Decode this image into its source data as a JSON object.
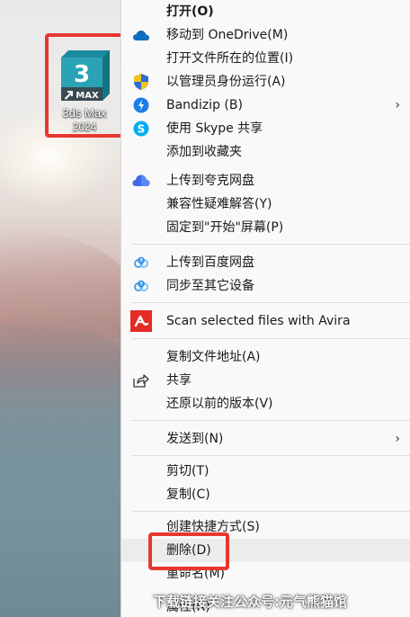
{
  "desktop": {
    "icon_label": "3ds Max",
    "icon_sublabel": "2024",
    "logo_number": "3",
    "logo_text": "MAX"
  },
  "menu": {
    "items": [
      {
        "label": "打开(O)",
        "icon": "none"
      },
      {
        "label": "移动到 OneDrive(M)",
        "icon": "onedrive-cloud-icon"
      },
      {
        "label": "打开文件所在的位置(I)",
        "icon": "none"
      },
      {
        "label": "以管理员身份运行(A)",
        "icon": "uac-shield-icon"
      },
      {
        "label": "Bandizip (B)",
        "icon": "bandizip-icon"
      },
      {
        "label": "使用 Skype 共享",
        "icon": "skype-icon"
      },
      {
        "label": "添加到收藏夹",
        "icon": "none"
      },
      {
        "label": "上传到夸克网盘",
        "icon": "quark-cloud-icon"
      },
      {
        "label": "兼容性疑难解答(Y)",
        "icon": "none"
      },
      {
        "label": "固定到\"开始\"屏幕(P)",
        "icon": "none"
      },
      {
        "label": "上传到百度网盘",
        "icon": "baidu-cloud-icon"
      },
      {
        "label": "同步至其它设备",
        "icon": "baidu-cloud-icon"
      },
      {
        "label": "Scan selected files with Avira",
        "icon": "avira-icon"
      },
      {
        "label": "复制文件地址(A)",
        "icon": "none"
      },
      {
        "label": "共享",
        "icon": "share-icon"
      },
      {
        "label": "还原以前的版本(V)",
        "icon": "none"
      },
      {
        "label": "发送到(N)",
        "icon": "none"
      },
      {
        "label": "剪切(T)",
        "icon": "none"
      },
      {
        "label": "复制(C)",
        "icon": "none"
      },
      {
        "label": "创建快捷方式(S)",
        "icon": "none"
      },
      {
        "label": "删除(D)",
        "icon": "none"
      },
      {
        "label": "重命名(M)",
        "icon": "none"
      },
      {
        "label": "属性(R)",
        "icon": "none"
      }
    ],
    "submenu_arrow": "›"
  },
  "colors": {
    "highlight": "#e8372f",
    "onedrive": "#0f6cbd",
    "bandizip": "#1e7ce8",
    "skype": "#00aff0",
    "avira": "#e42b26"
  },
  "watermark": "下载链接关注公众号:元气熊猫馆"
}
